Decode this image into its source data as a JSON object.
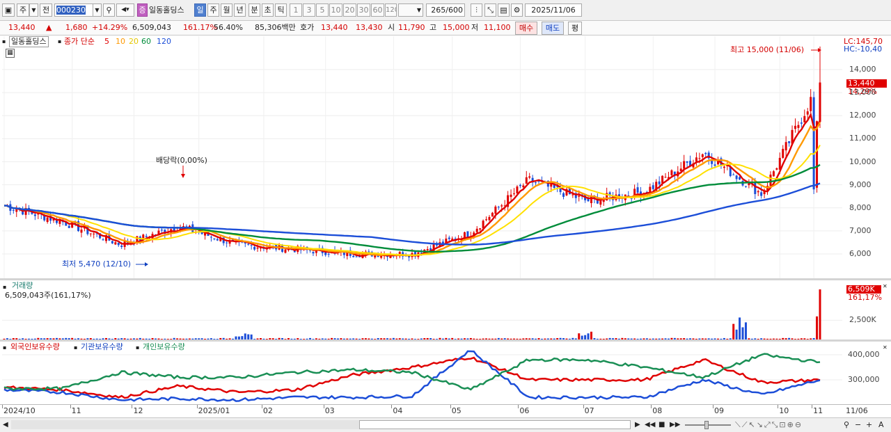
{
  "toolbar": {
    "market_tab1": "주",
    "market_tab2": "전",
    "code": "000230",
    "name_badge": "증",
    "stock_name": "일동홀딩스",
    "periods": [
      "일",
      "주",
      "월",
      "년",
      "분",
      "초",
      "틱"
    ],
    "tick_values": [
      "1",
      "3",
      "5",
      "10",
      "20",
      "30",
      "60",
      "120"
    ],
    "count": "265",
    "count_total": "/600",
    "date": "2025/11/06"
  },
  "quote": {
    "price": "13,440",
    "arrow": "▲",
    "change": "1,680",
    "pct": "+14.29%",
    "volume": "6,509,043",
    "vol_ratio": "161.17%",
    "turnover": "56.40%",
    "amount": "85,306백만",
    "ask_label": "호가",
    "ask": "13,440",
    "bid": "13,430",
    "open_label": "시",
    "open": "11,790",
    "high_label": "고",
    "high": "15,000",
    "low_label": "저",
    "low": "11,100",
    "buy": "매수",
    "sell": "매도",
    "avg": "평"
  },
  "price_panel": {
    "stock_name": "일동홀딩스",
    "ma_title": "종가 단순",
    "ma_periods": [
      "5",
      "10",
      "20",
      "60",
      "120"
    ],
    "ma_colors": [
      "#e00000",
      "#ff9900",
      "#ffe000",
      "#008c3a",
      "#1c4ed8"
    ],
    "high_note": "최고 15,000 (11/06)",
    "low_note": "최저 5,470 (12/10)",
    "dividend_note": "배당락(0,00%)",
    "lc": "LC:145,70",
    "hc": "HC:-10,40",
    "cur_price": "13,440",
    "cur_pct": "14,29%",
    "y_labels": [
      "14,000",
      "13,000",
      "12,000",
      "11,000",
      "10,000",
      "9,000",
      "8,000",
      "7,000",
      "6,000"
    ]
  },
  "volume_panel": {
    "title": "거래량",
    "info": "6,509,043주(161,17%)",
    "cur": "6,509K",
    "cur_pct": "161,17%",
    "y_labels": [
      "2,500K"
    ]
  },
  "holding_panel": {
    "series": [
      {
        "name": "외국인보유수량",
        "color": "#e00000"
      },
      {
        "name": "기관보유수량",
        "color": "#1c4ed8"
      },
      {
        "name": "개인보유수량",
        "color": "#1a8f55"
      }
    ],
    "y_labels": [
      "400,000",
      "300,000"
    ]
  },
  "x_labels": [
    "2024/10",
    "11",
    "12",
    "2025/01",
    "02",
    "03",
    "04",
    "05",
    "06",
    "07",
    "08",
    "09",
    "10",
    "11",
    "11/06"
  ],
  "chart_data": {
    "type": "candlestick",
    "x": [
      "2024/10",
      "11",
      "12",
      "2025/01",
      "02",
      "03",
      "04",
      "05",
      "06",
      "07",
      "08",
      "09",
      "10",
      "11",
      "11/06"
    ],
    "ylim": [
      5400,
      15000
    ],
    "close_track": [
      8100,
      7400,
      6400,
      7200,
      6400,
      6200,
      6000,
      6000,
      6900,
      9200,
      8300,
      8700,
      10400,
      8600,
      13440
    ],
    "high": 15000,
    "low": 5470,
    "volume_peak_k": 6509,
    "holdings": {
      "foreign": [
        270000,
        260000,
        230000,
        275000,
        250000,
        260000,
        320000,
        350000,
        390000,
        300000,
        300000,
        300000,
        380000,
        290000,
        300000
      ],
      "institution": [
        260000,
        250000,
        220000,
        225000,
        220000,
        230000,
        230000,
        235000,
        420000,
        230000,
        230000,
        230000,
        300000,
        240000,
        300000
      ],
      "individual": [
        265000,
        265000,
        330000,
        310000,
        310000,
        330000,
        340000,
        330000,
        260000,
        380000,
        380000,
        350000,
        310000,
        400000,
        370000
      ]
    }
  }
}
